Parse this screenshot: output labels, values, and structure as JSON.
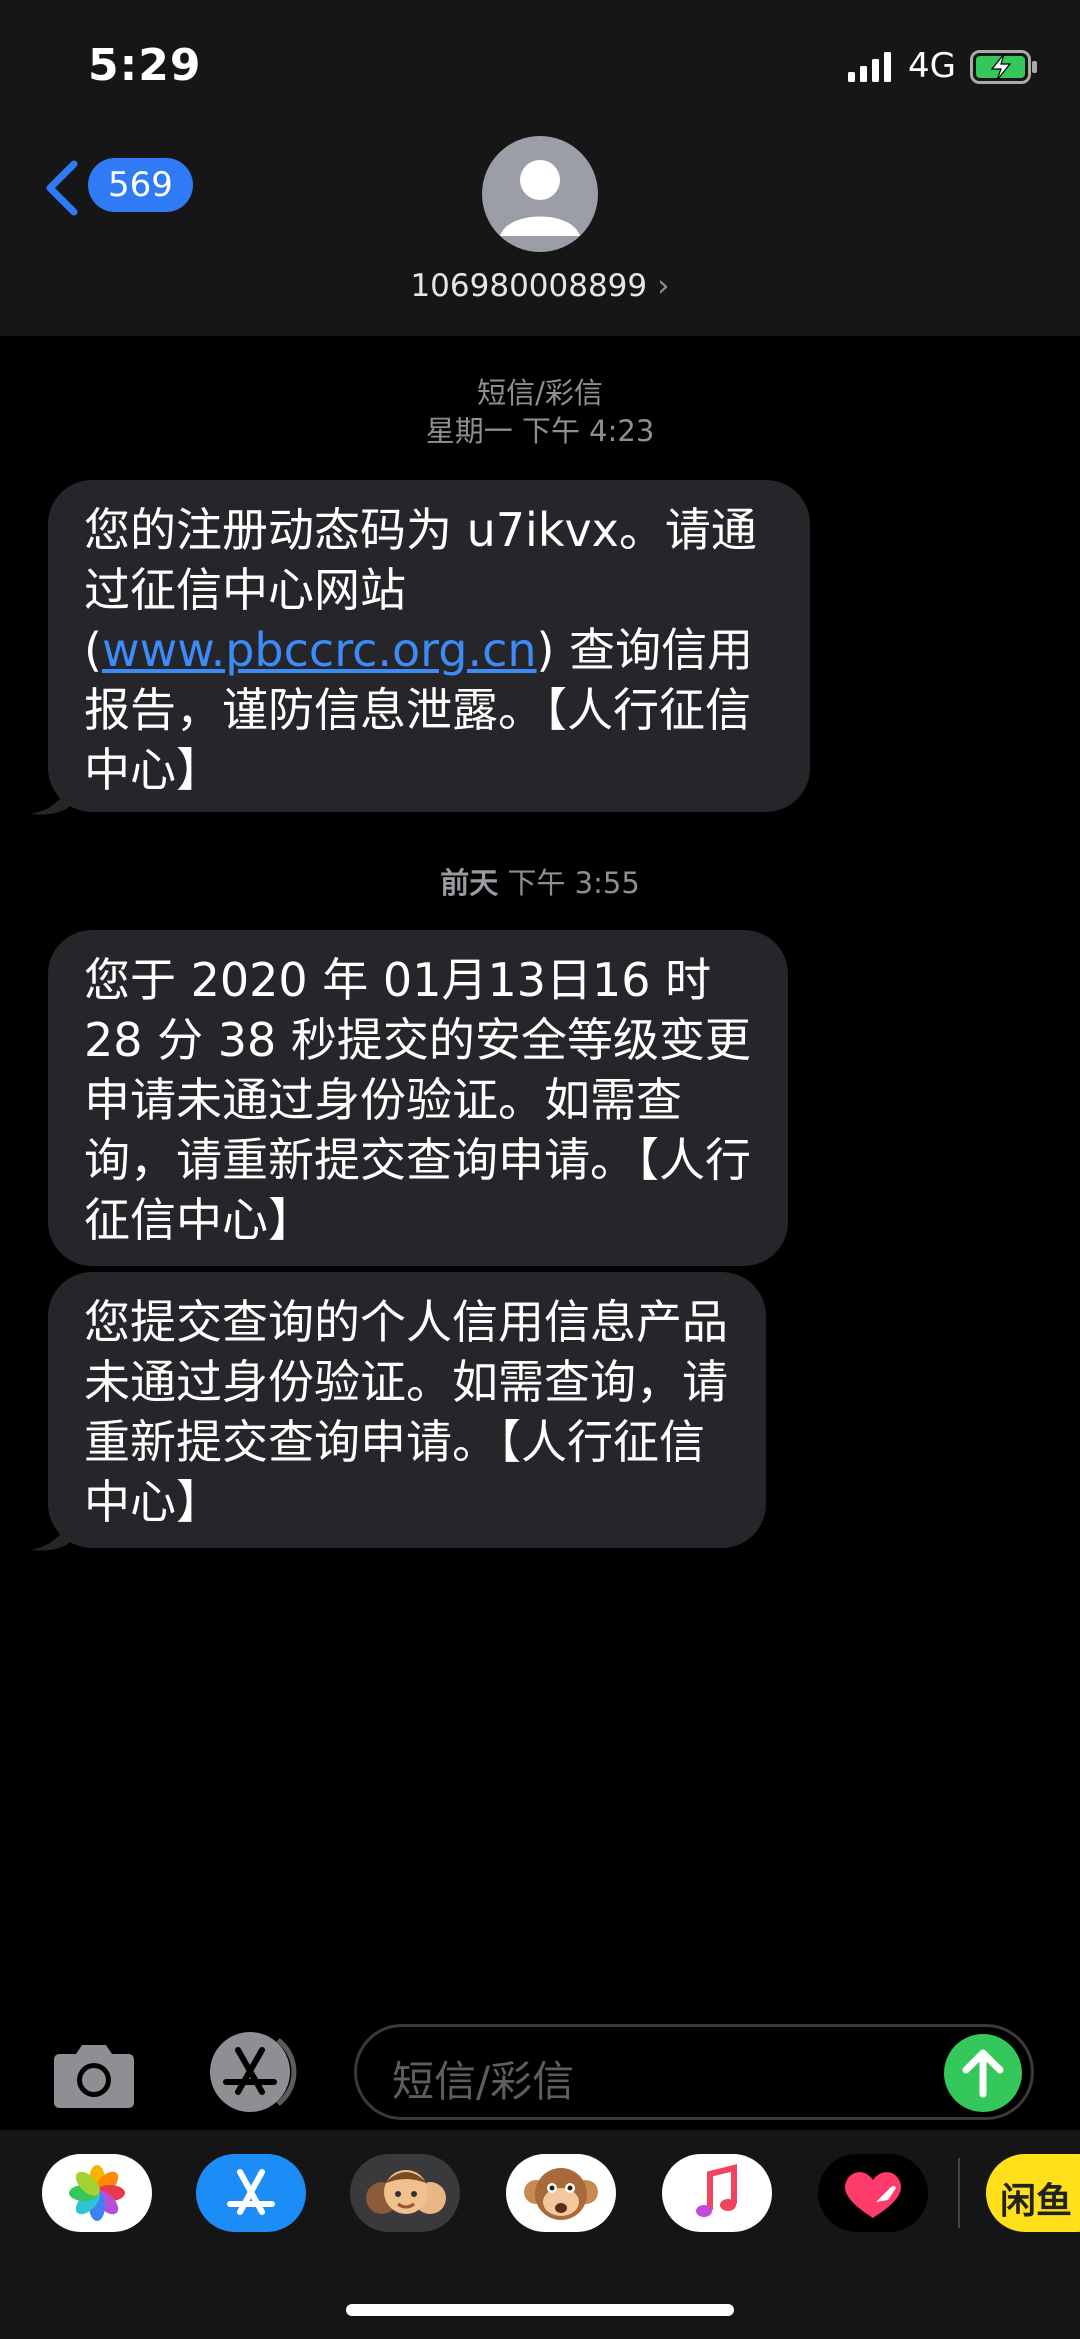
{
  "status_bar": {
    "time": "5:29",
    "network": "4G"
  },
  "header": {
    "back_count": "569",
    "contact": "106980008899"
  },
  "thread": {
    "service_label": "短信/彩信",
    "stamp1": {
      "day": "星期一",
      "time": "下午 4:23"
    },
    "msg1": {
      "before_link": "您的注册动态码为 u7ikvx。请通过征信中心网站",
      "paren_open": "(",
      "link": "www.pbccrc.org.cn",
      "after_link": ") 查询信用报告，谨防信息泄露。【人行征信中心】"
    },
    "stamp2": {
      "day": "前天",
      "time": "下午 3:55"
    },
    "msg2": "您于 2020 年 01月13日16 时 28 分 38 秒提交的安全等级变更申请未通过身份验证。如需查询，请重新提交查询申请。【人行征信中心】",
    "msg3": "您提交查询的个人信用信息产品未通过身份验证。如需查询，请重新提交查询申请。【人行征信中心】"
  },
  "composer": {
    "placeholder": "短信/彩信"
  },
  "drawer": {
    "apps": [
      "photos-icon",
      "app-store-icon",
      "memoji-icon",
      "animoji-icon",
      "music-icon",
      "digital-touch-icon",
      "xianyu-icon"
    ],
    "xianyu_label": "闲鱼"
  },
  "colors": {
    "bubble": "#26252a",
    "link": "#3d8bf7",
    "send": "#34c759",
    "badge": "#2f7bf6"
  }
}
